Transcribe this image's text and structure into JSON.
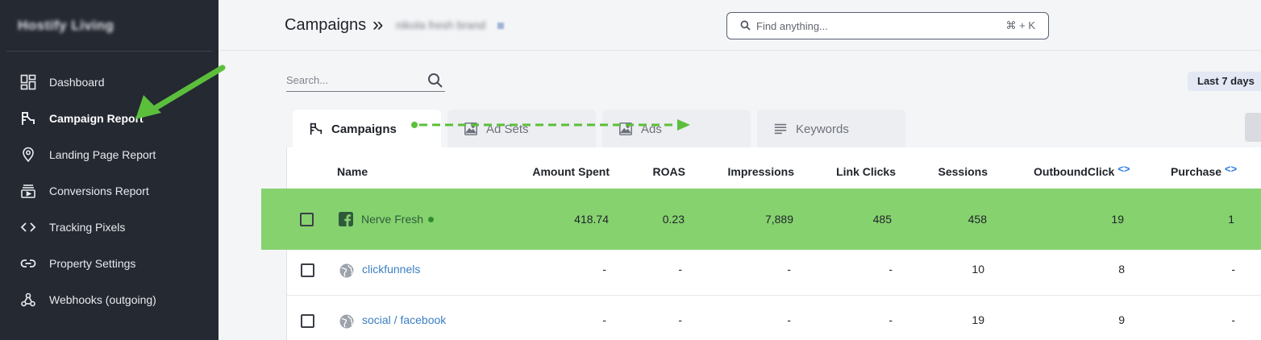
{
  "sidebar": {
    "brand": "Hostify Living",
    "items": [
      {
        "label": "Dashboard",
        "icon": "dashboard-icon"
      },
      {
        "label": "Campaign Report",
        "icon": "campaign-flag-icon",
        "active": true
      },
      {
        "label": "Landing Page Report",
        "icon": "location-pin-icon"
      },
      {
        "label": "Conversions Report",
        "icon": "conversions-icon"
      },
      {
        "label": "Tracking Pixels",
        "icon": "code-icon"
      },
      {
        "label": "Property Settings",
        "icon": "link-icon"
      },
      {
        "label": "Webhooks (outgoing)",
        "icon": "webhook-icon"
      }
    ]
  },
  "header": {
    "title": "Campaigns",
    "separator": "»",
    "subtitle": "nikola fresh brand",
    "search_placeholder": "Find anything...",
    "search_shortcut": "⌘ + K"
  },
  "filters": {
    "search_placeholder": "Search...",
    "date_range": "Last 7 days"
  },
  "tabs": [
    {
      "label": "Campaigns",
      "icon": "campaign-flag-icon",
      "active": true
    },
    {
      "label": "Ad Sets",
      "icon": "image-icon"
    },
    {
      "label": "Ads",
      "icon": "image-icon"
    },
    {
      "label": "Keywords",
      "icon": "lines-icon"
    }
  ],
  "table": {
    "columns": [
      "Name",
      "Amount Spent",
      "ROAS",
      "Impressions",
      "Link Clicks",
      "Sessions",
      "OutboundClick",
      "Purchase"
    ],
    "code_mark": "<>",
    "rows": [
      {
        "name": "Nerve Fresh",
        "source_icon": "facebook-icon",
        "live": true,
        "amount_spent": "418.74",
        "roas": "0.23",
        "impressions": "7,889",
        "link_clicks": "485",
        "sessions": "458",
        "outbound_click": "19",
        "purchase": "1"
      },
      {
        "name": "clickfunnels",
        "source_icon": "globe-icon",
        "live": false,
        "amount_spent": "-",
        "roas": "-",
        "impressions": "-",
        "link_clicks": "-",
        "sessions": "10",
        "outbound_click": "8",
        "purchase": "-"
      },
      {
        "name": "social / facebook",
        "source_icon": "globe-icon",
        "live": false,
        "amount_spent": "-",
        "roas": "-",
        "impressions": "-",
        "link_clicks": "-",
        "sessions": "19",
        "outbound_click": "9",
        "purchase": "-"
      }
    ]
  },
  "colors": {
    "sidebar_bg": "#252932",
    "highlight": "#86d26f",
    "annotation_arrow": "#5cbf3c",
    "link": "#3a7fc2"
  }
}
